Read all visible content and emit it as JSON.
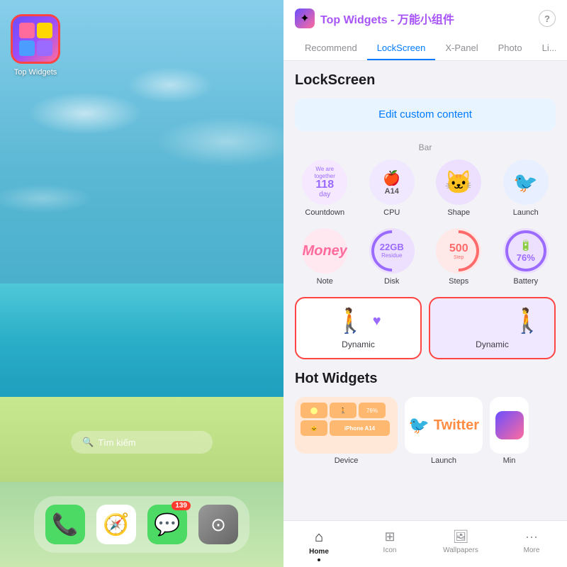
{
  "left": {
    "app_icon_label": "Top Widgets",
    "search_placeholder": "Tìm kiếm",
    "dock_items": [
      {
        "id": "phone",
        "emoji": "📞",
        "badge": null
      },
      {
        "id": "safari",
        "emoji": "🧭",
        "badge": null
      },
      {
        "id": "messages",
        "emoji": "💬",
        "badge": "139"
      },
      {
        "id": "camera",
        "emoji": "📷",
        "badge": null
      }
    ]
  },
  "right": {
    "header": {
      "title": "Top Widgets - 万能小组件",
      "help": "?",
      "tabs": [
        "Recommend",
        "LockScreen",
        "X-Panel",
        "Photo",
        "Li..."
      ],
      "active_tab": "LockScreen"
    },
    "section_title": "LockScreen",
    "edit_button_label": "Edit custom content",
    "bar_label": "Bar",
    "widgets": [
      {
        "id": "countdown",
        "line1": "We are together",
        "number": "118",
        "suffix": "day",
        "label": "Countdown"
      },
      {
        "id": "cpu",
        "brand": "",
        "model": "A14",
        "label": "CPU"
      },
      {
        "id": "shape",
        "label": "Shape"
      },
      {
        "id": "launch",
        "label": "Launch"
      },
      {
        "id": "note",
        "text": "Money",
        "label": "Note"
      },
      {
        "id": "disk",
        "value": "22GB",
        "sublabel": "Residue",
        "label": "Disk"
      },
      {
        "id": "steps",
        "value": "500",
        "sublabel": "Step",
        "label": "Steps"
      },
      {
        "id": "battery",
        "value": "76%",
        "label": "Battery"
      }
    ],
    "dynamic_items": [
      {
        "id": "dynamic-left",
        "label": "Dynamic"
      },
      {
        "id": "dynamic-right",
        "label": "Dynamic"
      }
    ],
    "hot_widgets_title": "Hot Widgets",
    "hot_items": [
      {
        "id": "device",
        "label": "Device"
      },
      {
        "id": "twitter-launch",
        "label": "Launch"
      },
      {
        "id": "mini-partial",
        "label": "Min"
      }
    ],
    "bottom_nav": [
      {
        "id": "home",
        "icon": "⌂",
        "label": "Home",
        "active": true
      },
      {
        "id": "icon",
        "icon": "⊞",
        "label": "Icon",
        "active": false
      },
      {
        "id": "wallpapers",
        "icon": "🖼",
        "label": "Wallpapers",
        "active": false
      },
      {
        "id": "more",
        "icon": "…",
        "label": "More",
        "active": false
      }
    ]
  }
}
